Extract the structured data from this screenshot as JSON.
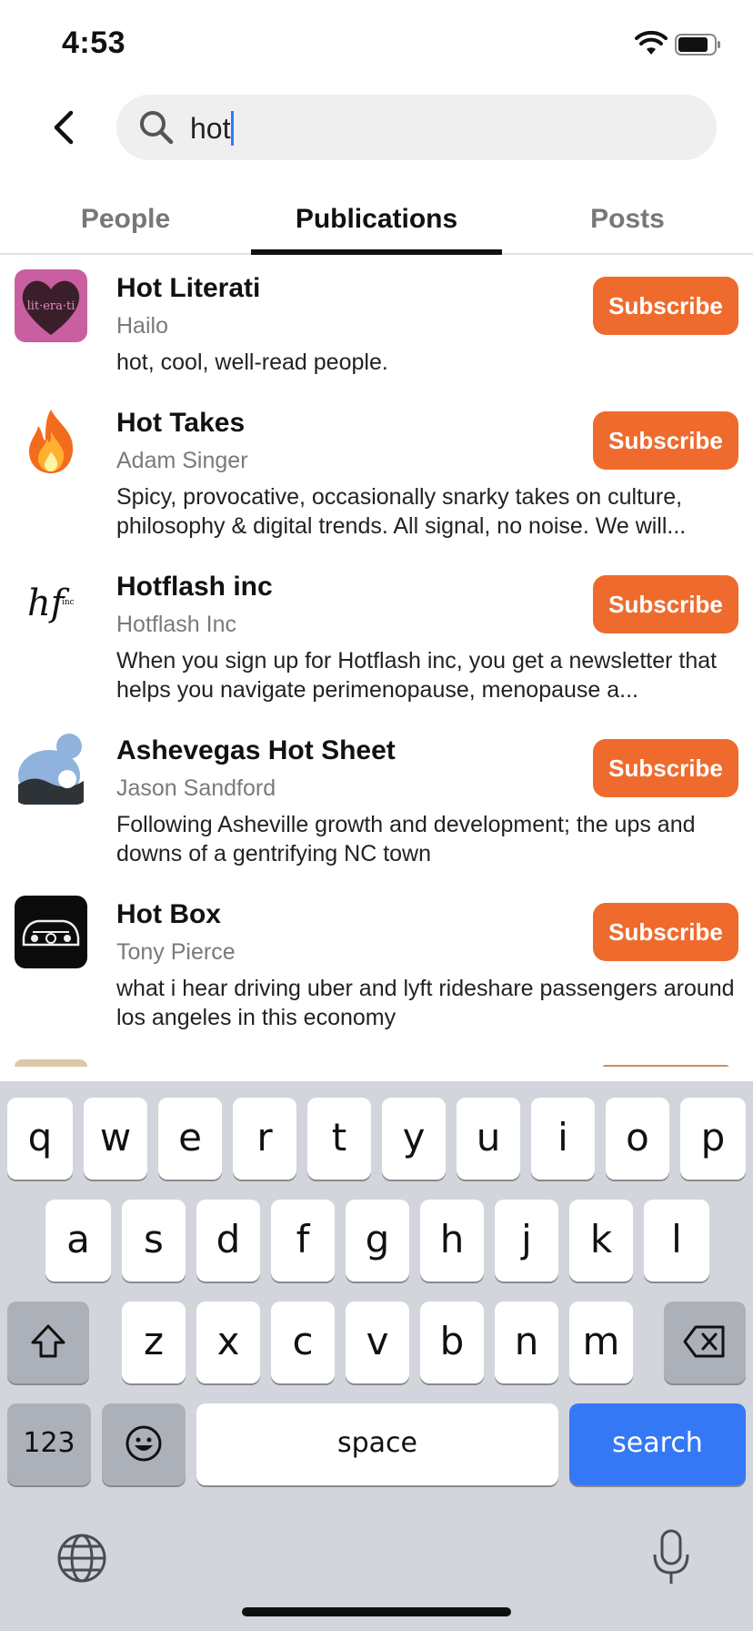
{
  "status": {
    "time": "4:53"
  },
  "search": {
    "query": "hot"
  },
  "tabs": [
    {
      "label": "People",
      "active": false
    },
    {
      "label": "Publications",
      "active": true
    },
    {
      "label": "Posts",
      "active": false
    }
  ],
  "publications": [
    {
      "title": "Hot Literati",
      "author": "Hailo",
      "description": "hot, cool, well-read people.",
      "button": "Subscribe",
      "logo_text": "lit·era·ti"
    },
    {
      "title": "Hot Takes",
      "author": "Adam Singer",
      "description": "Spicy, provocative, occasionally snarky takes on culture, philosophy & digital trends. All signal, no noise. We will...",
      "button": "Subscribe"
    },
    {
      "title": "Hotflash inc",
      "author": "Hotflash Inc",
      "description": "When you sign up for Hotflash inc, you get a newsletter that helps you navigate perimenopause, menopause a...",
      "button": "Subscribe",
      "logo_text": "hf",
      "logo_sub": "inc"
    },
    {
      "title": "Ashevegas Hot Sheet",
      "author": "Jason Sandford",
      "description": "Following Asheville growth and development; the ups and downs of a gentrifying NC town",
      "button": "Subscribe"
    },
    {
      "title": "Hot Box",
      "author": "Tony Pierce",
      "description": "what i hear driving uber and lyft rideshare passengers around los angeles in this economy",
      "button": "Subscribe"
    }
  ],
  "keyboard": {
    "row1": [
      "q",
      "w",
      "e",
      "r",
      "t",
      "y",
      "u",
      "i",
      "o",
      "p"
    ],
    "row2": [
      "a",
      "s",
      "d",
      "f",
      "g",
      "h",
      "j",
      "k",
      "l"
    ],
    "row3": [
      "z",
      "x",
      "c",
      "v",
      "b",
      "n",
      "m"
    ],
    "numbers_label": "123",
    "space_label": "space",
    "action_label": "search"
  },
  "colors": {
    "accent": "#ef6b2d",
    "keyboard_action": "#3478f6"
  }
}
